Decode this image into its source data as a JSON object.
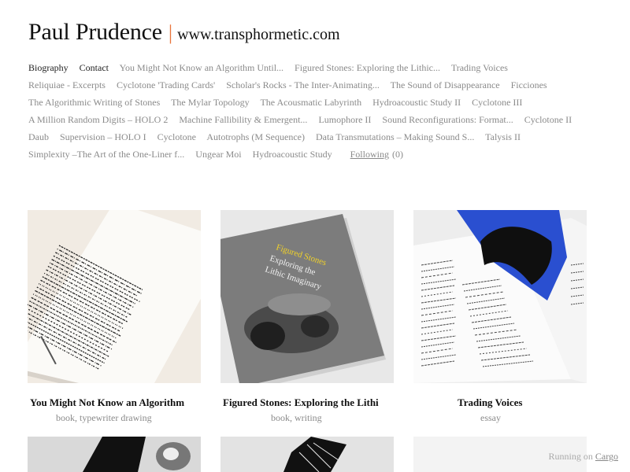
{
  "header": {
    "site_title": "Paul Prudence",
    "separator": "|",
    "site_url": "www.transphormetic.com"
  },
  "nav": {
    "items": [
      {
        "label": "Biography",
        "strong": true
      },
      {
        "label": "Contact",
        "strong": true
      },
      {
        "label": "You Might Not Know an Algorithm Until..."
      },
      {
        "label": "Figured Stones: Exploring the Lithic..."
      },
      {
        "label": "Trading Voices"
      },
      {
        "label": "Reliquiae - Excerpts"
      },
      {
        "label": "Cyclotone 'Trading Cards'"
      },
      {
        "label": "Scholar's Rocks - The Inter-Animating..."
      },
      {
        "label": "The Sound of Disappearance"
      },
      {
        "label": "Ficciones"
      },
      {
        "label": "The Algorithmic Writing of Stones"
      },
      {
        "label": "The Mylar Topology"
      },
      {
        "label": "The Acousmatic Labyrinth"
      },
      {
        "label": "Hydroacoustic Study II"
      },
      {
        "label": "Cyclotone III"
      },
      {
        "label": "A Million Random Digits – HOLO 2"
      },
      {
        "label": "Machine Fallibility & Emergent..."
      },
      {
        "label": "Lumophore II"
      },
      {
        "label": "Sound Reconfigurations: Format..."
      },
      {
        "label": "Cyclotone II"
      },
      {
        "label": "Daub"
      },
      {
        "label": "Supervision – HOLO I"
      },
      {
        "label": "Cyclotone"
      },
      {
        "label": "Autotrophs (M Sequence)"
      },
      {
        "label": "Data Transmutations – Making Sound S..."
      },
      {
        "label": "Talysis II"
      },
      {
        "label": "Simplexity –The Art of the One-Liner f..."
      },
      {
        "label": "Ungear Moi"
      },
      {
        "label": "Hydroacoustic Study"
      }
    ],
    "following_label": "Following",
    "following_count": "(0)"
  },
  "tiles": [
    {
      "title": "You Might Not Know an Algorithm",
      "tags": [
        "book",
        "typewriter drawing"
      ]
    },
    {
      "title": "Figured Stones: Exploring the Lithi",
      "tags": [
        "book",
        "writing"
      ],
      "cover_text": [
        "Figured Stones",
        "Exploring the",
        "Lithic Imaginary"
      ]
    },
    {
      "title": "Trading Voices",
      "tags": [
        "essay"
      ]
    }
  ],
  "footer": {
    "running_on": "Running on",
    "platform": "Cargo"
  },
  "colors": {
    "accent": "#e8743b",
    "nav_text": "#8a8a8a",
    "title_text": "#111111"
  }
}
